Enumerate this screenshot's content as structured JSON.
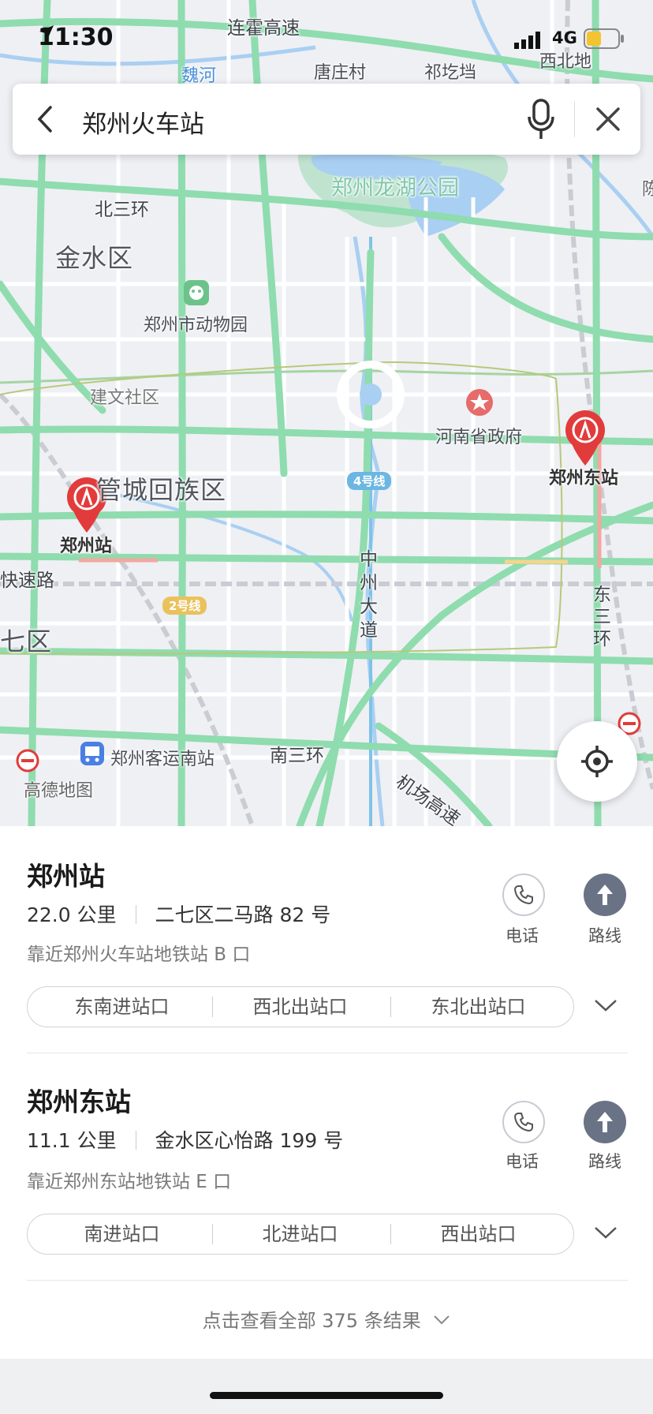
{
  "status": {
    "time": "11:30",
    "network": "4G"
  },
  "search": {
    "query": "郑州火车站"
  },
  "map": {
    "road_labels": [
      "连霍高速",
      "北三环",
      "中州大道",
      "东三环",
      "南三环",
      "机场高速",
      "快速路"
    ],
    "district_labels": [
      "金水区",
      "管城回族区",
      "七区"
    ],
    "place_labels": [
      "唐庄村",
      "祁圪垱",
      "西北地",
      "建文社区",
      "郑州市动物园",
      "河南省政府",
      "郑州站",
      "郑州东站",
      "郑州客运南站"
    ],
    "water_labels": [
      "魏河"
    ],
    "park_labels": [
      "郑州龙湖公园",
      "陈"
    ],
    "metro_lines": [
      "4号线",
      "2号线"
    ],
    "watermark": "高德地图",
    "colors": {
      "road": "#8fdcae",
      "water": "#a9cff2",
      "pin": "#e23b3b",
      "park": "#bfe3cf"
    }
  },
  "results": [
    {
      "name": "郑州站",
      "distance": "22.0 公里",
      "address": "二七区二马路 82 号",
      "nearby": "靠近郑州火车站地铁站 B 口",
      "entrances": [
        "东南进站口",
        "西北出站口",
        "东北出站口"
      ]
    },
    {
      "name": "郑州东站",
      "distance": "11.1 公里",
      "address": "金水区心怡路 199 号",
      "nearby": "靠近郑州东站地铁站 E 口",
      "entrances": [
        "南进站口",
        "北进站口",
        "西出站口"
      ]
    }
  ],
  "actions": {
    "phone": "电话",
    "route": "路线"
  },
  "more": "点击查看全部 375 条结果"
}
